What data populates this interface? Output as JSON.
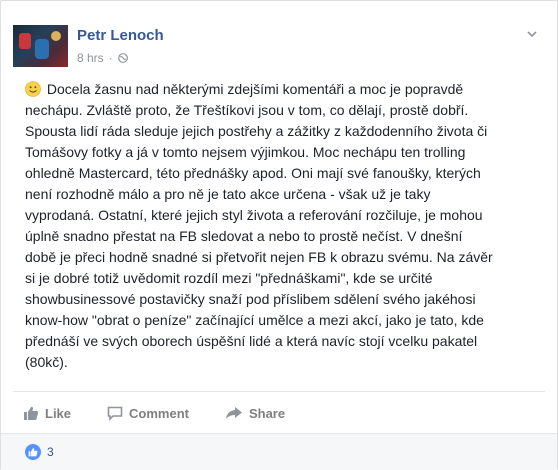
{
  "post": {
    "author": "Petr Lenoch",
    "time": "8 hrs",
    "dot": "·",
    "text": "Docela žasnu nad některými zdejšími komentáři a moc je popravdě\nnechápu. Zvláště proto, že Třeštíkovi jsou v tom, co dělají, prostě dobří.\nSpousta lidí ráda sleduje jejich postřehy a zážitky z každodenního života či\nTomášovy fotky a já v tomto nejsem výjimkou. Moc nechápu ten trolling\nohledně Mastercard, této přednášky apod. Oni mají své fanoušky, kterých\nnení rozhodně málo a pro ně je tato akce určena - však už je taky\nvyprodaná. Ostatní, které jejich styl života a referování rozčiluje, je mohou\núplně snadno přestat na FB sledovat a nebo to prostě nečíst. V dnešní\ndobě je přeci hodně snadné si přetvořit nejen FB k obrazu svému. Na závěr\nsi je dobré totiž uvědomit rozdíl mezi \"přednáškami\", kde se určité\nshowbusinessové postavičky snaží pod příslibem sdělení svého jakéhosi\nknow-how \"obrat o peníze\" začínající umělce a mezi akcí, jako je tato, kde\npřednáší ve svých oborech úspěšní lidé a která navíc stojí vcelku pakatel\n(80kč)."
  },
  "actions": {
    "like": "Like",
    "comment": "Comment",
    "share": "Share"
  },
  "reactions": {
    "count": "3"
  },
  "colors": {
    "link": "#365899",
    "muted": "#90949c",
    "like_blue": "#5890ff"
  }
}
